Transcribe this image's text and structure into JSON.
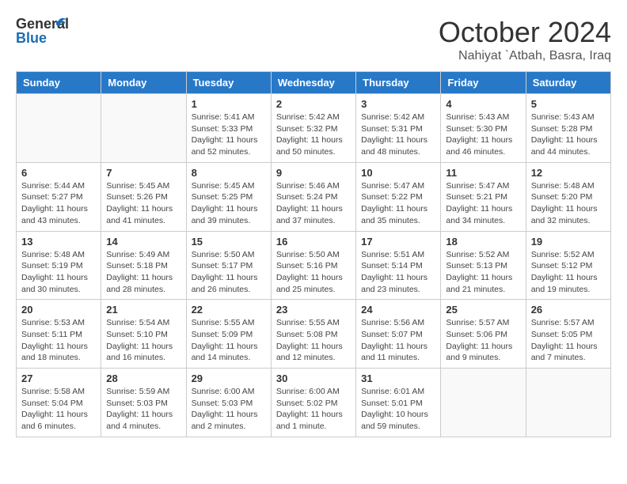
{
  "logo": {
    "general": "General",
    "blue": "Blue"
  },
  "title": "October 2024",
  "subtitle": "Nahiyat `Atbah, Basra, Iraq",
  "headers": [
    "Sunday",
    "Monday",
    "Tuesday",
    "Wednesday",
    "Thursday",
    "Friday",
    "Saturday"
  ],
  "weeks": [
    [
      {
        "day": "",
        "info": ""
      },
      {
        "day": "",
        "info": ""
      },
      {
        "day": "1",
        "info": "Sunrise: 5:41 AM\nSunset: 5:33 PM\nDaylight: 11 hours and 52 minutes."
      },
      {
        "day": "2",
        "info": "Sunrise: 5:42 AM\nSunset: 5:32 PM\nDaylight: 11 hours and 50 minutes."
      },
      {
        "day": "3",
        "info": "Sunrise: 5:42 AM\nSunset: 5:31 PM\nDaylight: 11 hours and 48 minutes."
      },
      {
        "day": "4",
        "info": "Sunrise: 5:43 AM\nSunset: 5:30 PM\nDaylight: 11 hours and 46 minutes."
      },
      {
        "day": "5",
        "info": "Sunrise: 5:43 AM\nSunset: 5:28 PM\nDaylight: 11 hours and 44 minutes."
      }
    ],
    [
      {
        "day": "6",
        "info": "Sunrise: 5:44 AM\nSunset: 5:27 PM\nDaylight: 11 hours and 43 minutes."
      },
      {
        "day": "7",
        "info": "Sunrise: 5:45 AM\nSunset: 5:26 PM\nDaylight: 11 hours and 41 minutes."
      },
      {
        "day": "8",
        "info": "Sunrise: 5:45 AM\nSunset: 5:25 PM\nDaylight: 11 hours and 39 minutes."
      },
      {
        "day": "9",
        "info": "Sunrise: 5:46 AM\nSunset: 5:24 PM\nDaylight: 11 hours and 37 minutes."
      },
      {
        "day": "10",
        "info": "Sunrise: 5:47 AM\nSunset: 5:22 PM\nDaylight: 11 hours and 35 minutes."
      },
      {
        "day": "11",
        "info": "Sunrise: 5:47 AM\nSunset: 5:21 PM\nDaylight: 11 hours and 34 minutes."
      },
      {
        "day": "12",
        "info": "Sunrise: 5:48 AM\nSunset: 5:20 PM\nDaylight: 11 hours and 32 minutes."
      }
    ],
    [
      {
        "day": "13",
        "info": "Sunrise: 5:48 AM\nSunset: 5:19 PM\nDaylight: 11 hours and 30 minutes."
      },
      {
        "day": "14",
        "info": "Sunrise: 5:49 AM\nSunset: 5:18 PM\nDaylight: 11 hours and 28 minutes."
      },
      {
        "day": "15",
        "info": "Sunrise: 5:50 AM\nSunset: 5:17 PM\nDaylight: 11 hours and 26 minutes."
      },
      {
        "day": "16",
        "info": "Sunrise: 5:50 AM\nSunset: 5:16 PM\nDaylight: 11 hours and 25 minutes."
      },
      {
        "day": "17",
        "info": "Sunrise: 5:51 AM\nSunset: 5:14 PM\nDaylight: 11 hours and 23 minutes."
      },
      {
        "day": "18",
        "info": "Sunrise: 5:52 AM\nSunset: 5:13 PM\nDaylight: 11 hours and 21 minutes."
      },
      {
        "day": "19",
        "info": "Sunrise: 5:52 AM\nSunset: 5:12 PM\nDaylight: 11 hours and 19 minutes."
      }
    ],
    [
      {
        "day": "20",
        "info": "Sunrise: 5:53 AM\nSunset: 5:11 PM\nDaylight: 11 hours and 18 minutes."
      },
      {
        "day": "21",
        "info": "Sunrise: 5:54 AM\nSunset: 5:10 PM\nDaylight: 11 hours and 16 minutes."
      },
      {
        "day": "22",
        "info": "Sunrise: 5:55 AM\nSunset: 5:09 PM\nDaylight: 11 hours and 14 minutes."
      },
      {
        "day": "23",
        "info": "Sunrise: 5:55 AM\nSunset: 5:08 PM\nDaylight: 11 hours and 12 minutes."
      },
      {
        "day": "24",
        "info": "Sunrise: 5:56 AM\nSunset: 5:07 PM\nDaylight: 11 hours and 11 minutes."
      },
      {
        "day": "25",
        "info": "Sunrise: 5:57 AM\nSunset: 5:06 PM\nDaylight: 11 hours and 9 minutes."
      },
      {
        "day": "26",
        "info": "Sunrise: 5:57 AM\nSunset: 5:05 PM\nDaylight: 11 hours and 7 minutes."
      }
    ],
    [
      {
        "day": "27",
        "info": "Sunrise: 5:58 AM\nSunset: 5:04 PM\nDaylight: 11 hours and 6 minutes."
      },
      {
        "day": "28",
        "info": "Sunrise: 5:59 AM\nSunset: 5:03 PM\nDaylight: 11 hours and 4 minutes."
      },
      {
        "day": "29",
        "info": "Sunrise: 6:00 AM\nSunset: 5:03 PM\nDaylight: 11 hours and 2 minutes."
      },
      {
        "day": "30",
        "info": "Sunrise: 6:00 AM\nSunset: 5:02 PM\nDaylight: 11 hours and 1 minute."
      },
      {
        "day": "31",
        "info": "Sunrise: 6:01 AM\nSunset: 5:01 PM\nDaylight: 10 hours and 59 minutes."
      },
      {
        "day": "",
        "info": ""
      },
      {
        "day": "",
        "info": ""
      }
    ]
  ]
}
